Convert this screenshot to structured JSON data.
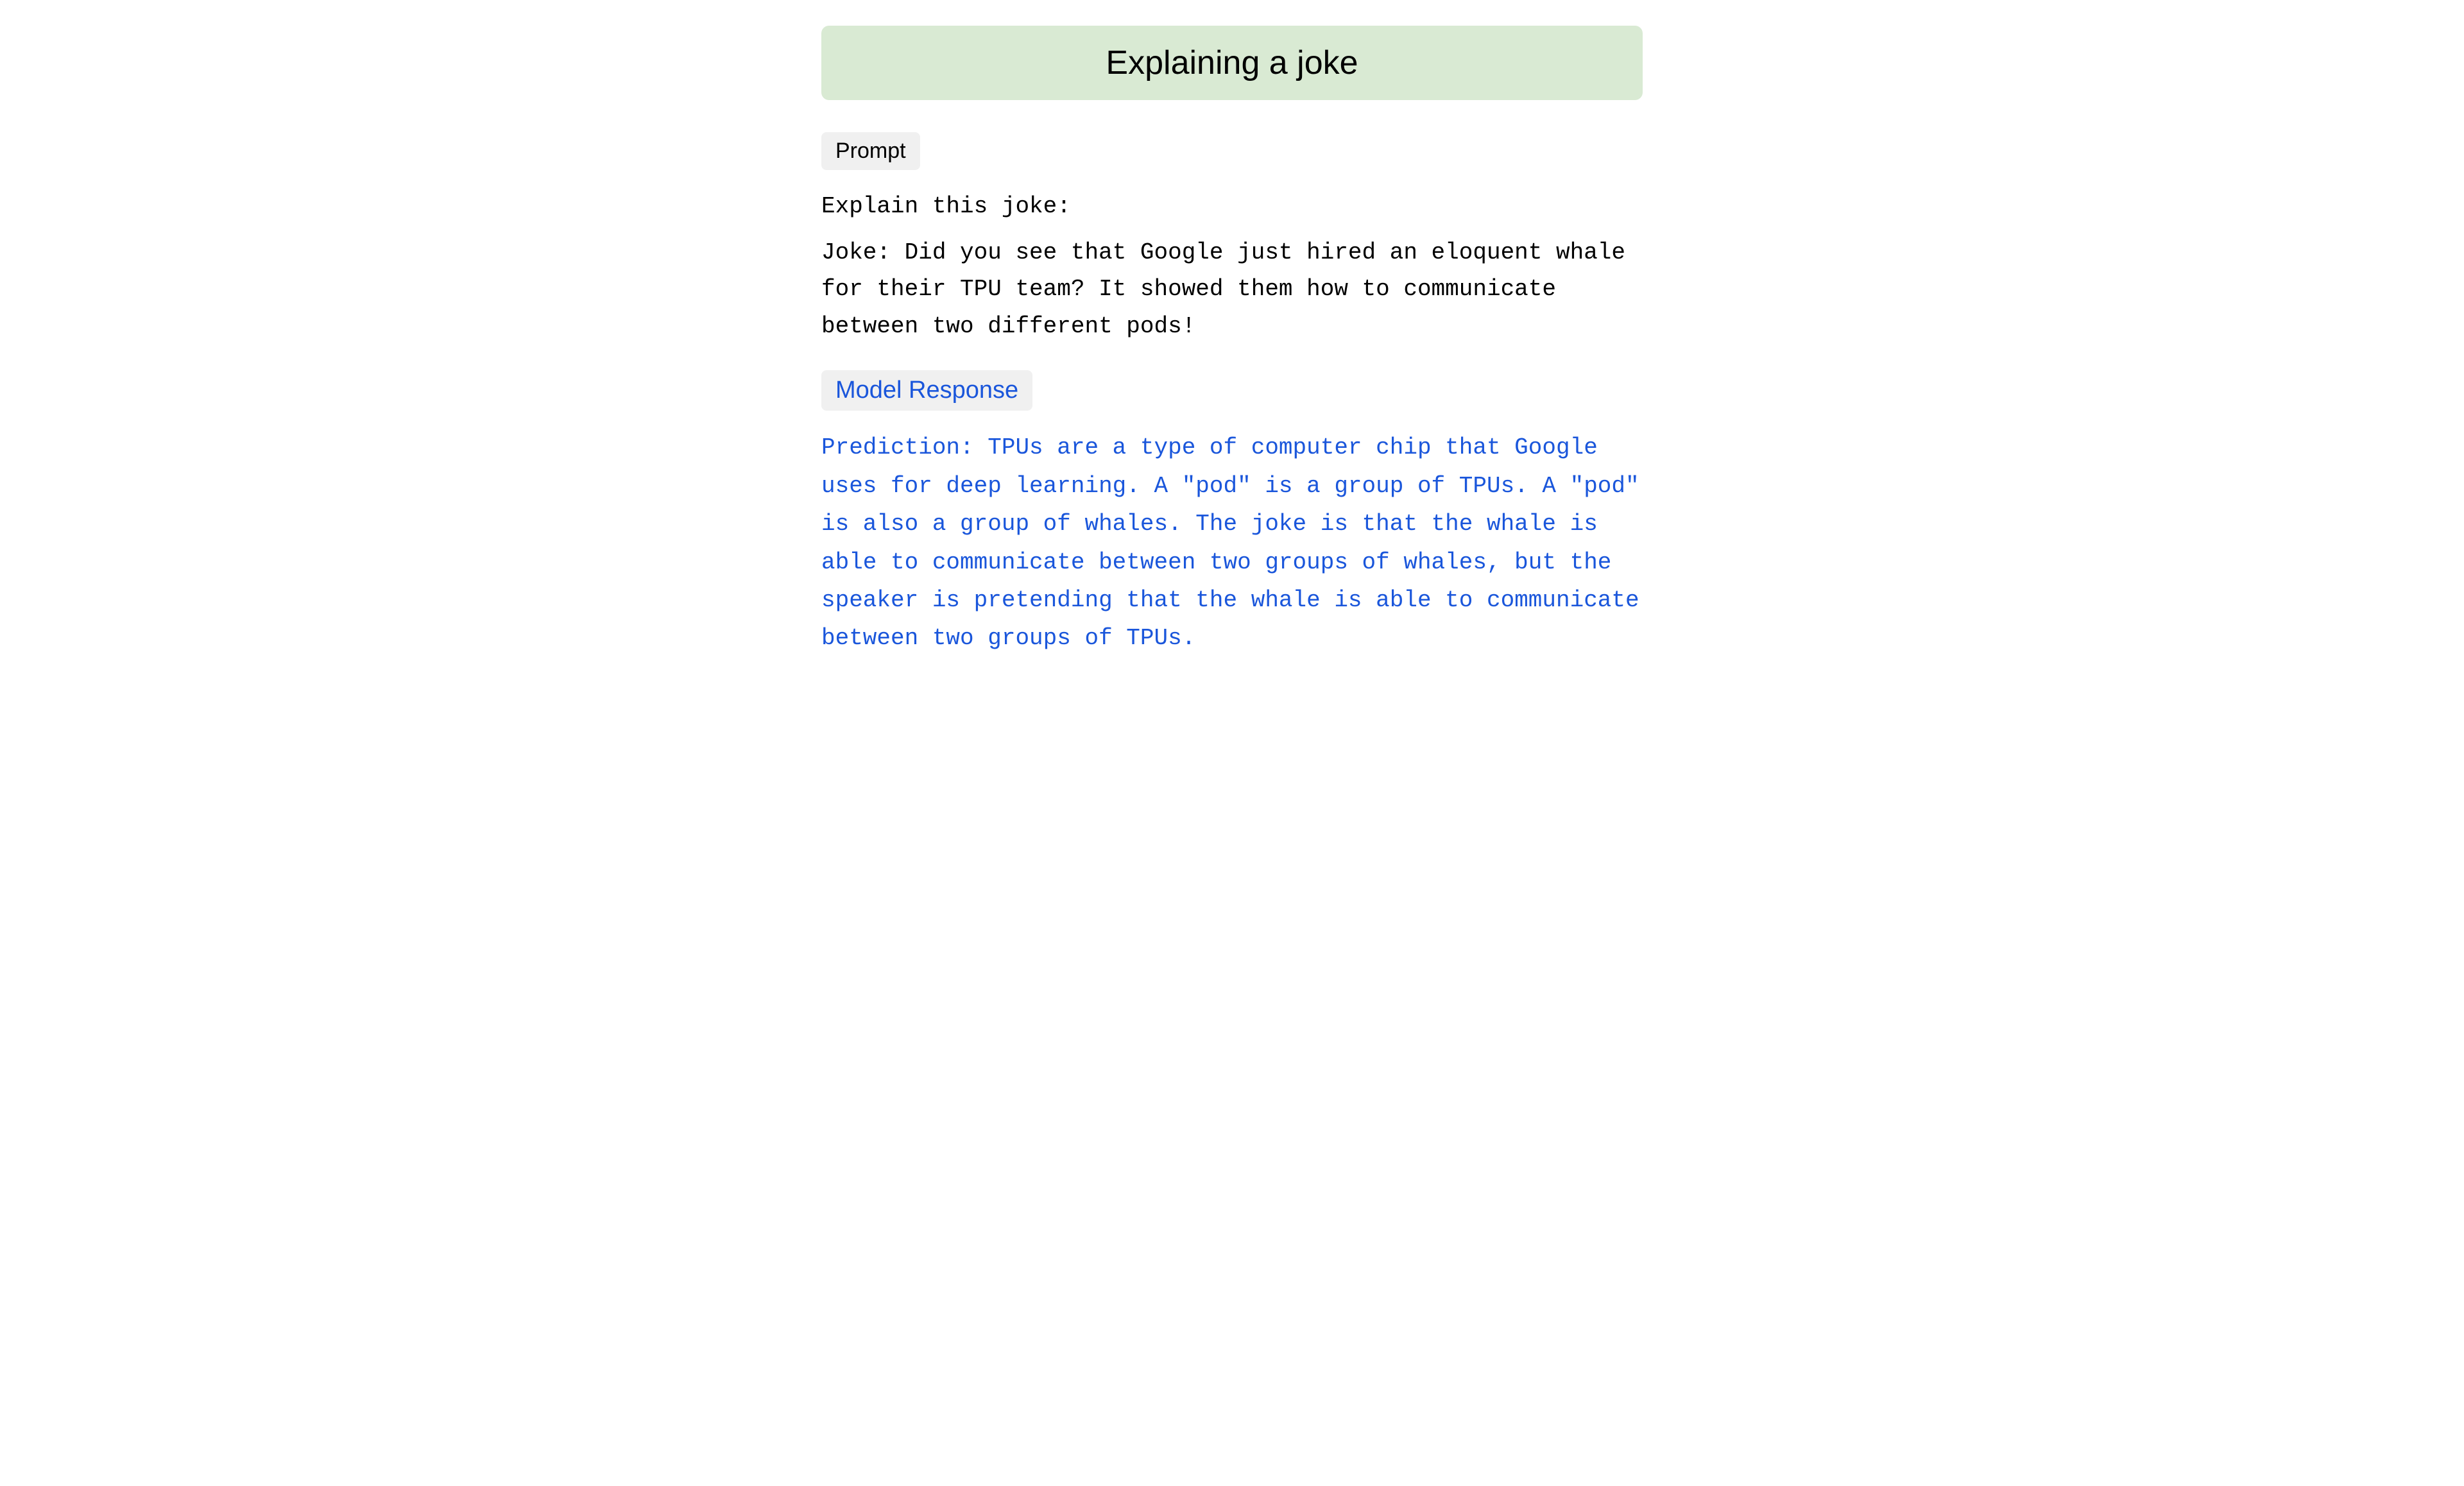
{
  "header": {
    "title": "Explaining a joke",
    "background_color": "#d9ead3"
  },
  "prompt_section": {
    "label": "Prompt",
    "intro_line": "Explain this joke:",
    "joke_text": "Joke: Did you see that Google just hired an eloquent whale for their TPU team? It showed them how to communicate between two different pods!"
  },
  "response_section": {
    "label": "Model Response",
    "response_text": "Prediction: TPUs are a type of computer chip that Google uses for deep learning. A \"pod\" is a group of TPUs. A \"pod\" is also a group of whales. The joke is that the whale is able to communicate between two groups of whales, but the speaker is pretending that the whale is able to communicate between two groups of TPUs."
  }
}
